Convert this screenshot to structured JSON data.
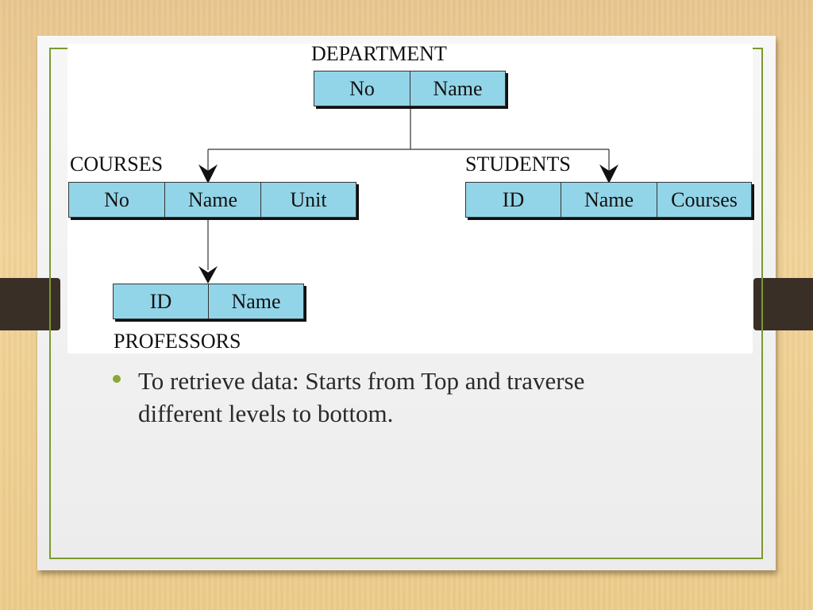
{
  "slide": {
    "diagram": {
      "tables": {
        "department": {
          "name": "DEPARTMENT",
          "fields": [
            "No",
            "Name"
          ]
        },
        "courses": {
          "name": "COURSES",
          "fields": [
            "No",
            "Name",
            "Unit"
          ]
        },
        "students": {
          "name": "STUDENTS",
          "fields": [
            "ID",
            "Name",
            "Courses"
          ]
        },
        "professors": {
          "name": "PROFESSORS",
          "fields": [
            "ID",
            "Name"
          ]
        }
      },
      "cell_color": "#93d5e8"
    },
    "bullets": [
      {
        "text": "To retrieve data: Starts from Top and traverse different levels to bottom."
      }
    ],
    "accent_color": "#7a9a2e"
  }
}
